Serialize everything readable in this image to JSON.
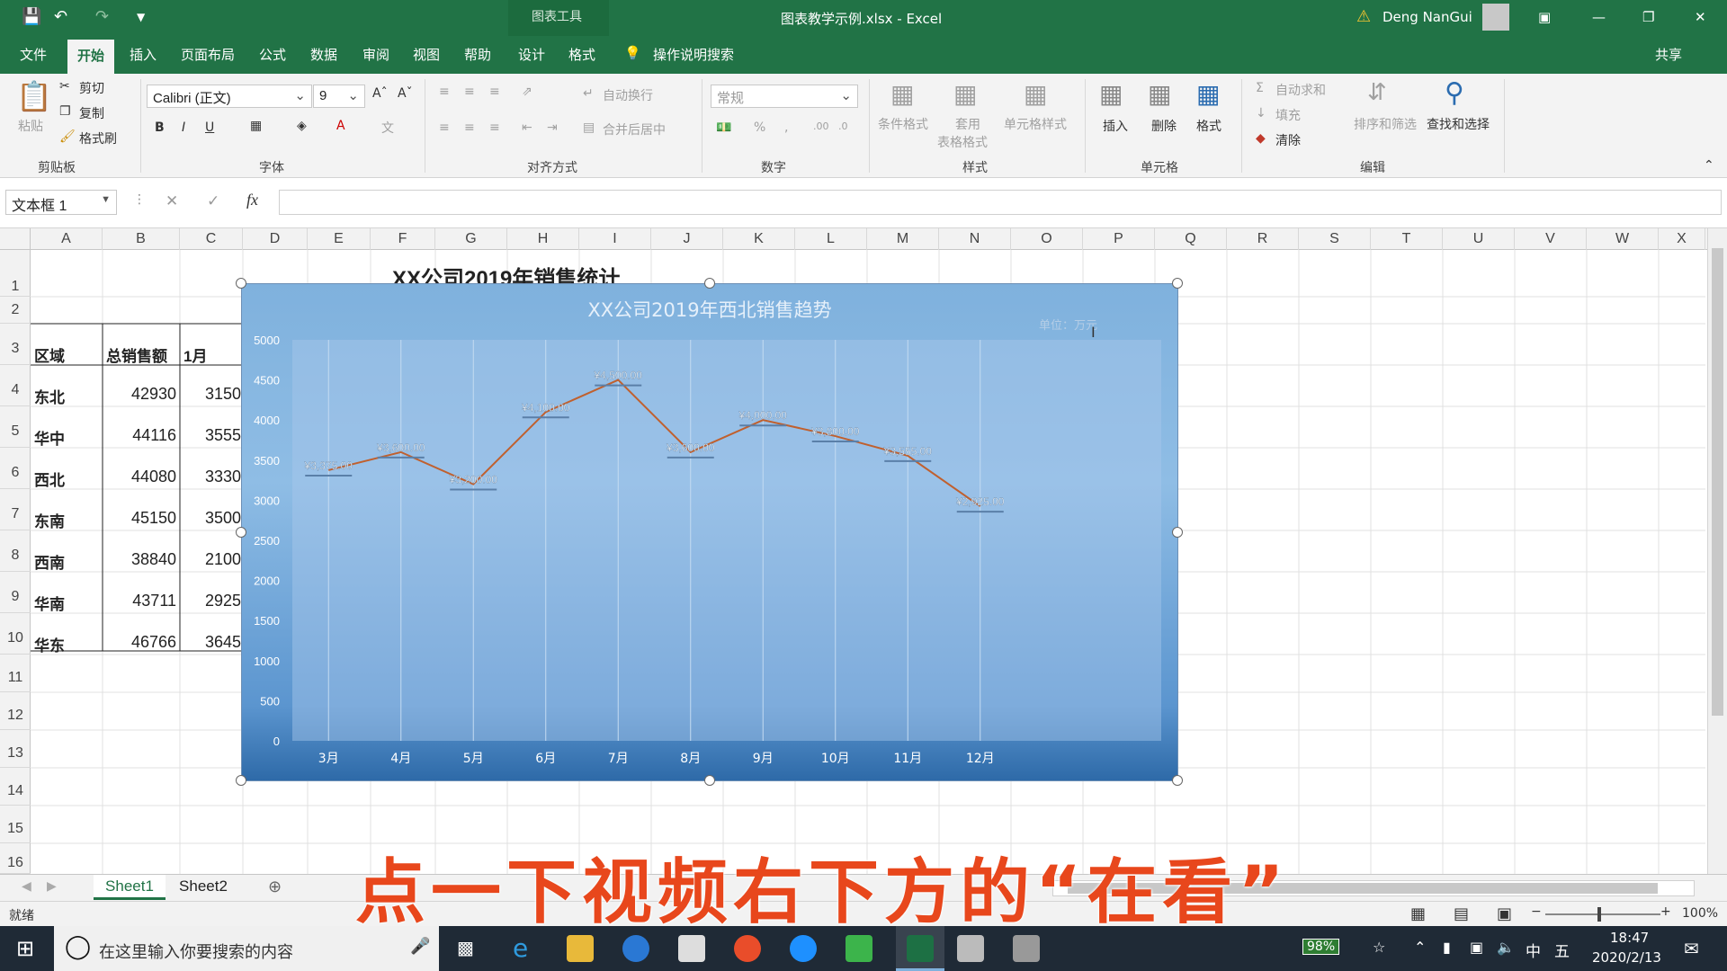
{
  "window": {
    "context_tab": "图表工具",
    "title": "图表教学示例.xlsx - Excel",
    "user": "Deng NanGui"
  },
  "tabs": [
    "文件",
    "开始",
    "插入",
    "页面布局",
    "公式",
    "数据",
    "审阅",
    "视图",
    "帮助",
    "设计",
    "格式"
  ],
  "tell_me": "操作说明搜索",
  "share": "共享",
  "ribbon": {
    "clipboard": {
      "paste": "粘贴",
      "cut": "剪切",
      "copy": "复制",
      "painter": "格式刷",
      "group": "剪贴板"
    },
    "font": {
      "name": "Calibri (正文)",
      "size": "9",
      "group": "字体"
    },
    "align": {
      "wrap": "自动换行",
      "merge": "合并后居中",
      "group": "对齐方式"
    },
    "number": {
      "format": "常规",
      "group": "数字"
    },
    "styles": {
      "cond": "条件格式",
      "table1": "套用",
      "table2": "表格格式",
      "cell": "单元格样式",
      "group": "样式"
    },
    "cells": {
      "insert": "插入",
      "delete": "删除",
      "format": "格式",
      "group": "单元格"
    },
    "editing": {
      "autosum": "自动求和",
      "fill": "填充",
      "clear": "清除",
      "sort": "排序和筛选",
      "find": "查找和选择",
      "group": "编辑"
    }
  },
  "formula_bar": {
    "name_box": "文本框 1",
    "value": ""
  },
  "columns": [
    "A",
    "B",
    "C",
    "D",
    "E",
    "F",
    "G",
    "H",
    "I",
    "J",
    "K",
    "L",
    "M",
    "N",
    "O",
    "P",
    "Q",
    "R",
    "S",
    "T",
    "U",
    "V",
    "W",
    "X"
  ],
  "rows": [
    "1",
    "2",
    "3",
    "4",
    "5",
    "6",
    "7",
    "8",
    "9",
    "10",
    "11",
    "12",
    "13",
    "14",
    "15",
    "16"
  ],
  "sheet": {
    "title": "XX公司2019年销售统计",
    "headers": [
      "区域",
      "总销售额",
      "1月"
    ],
    "data": [
      [
        "东北",
        "42930",
        "3150"
      ],
      [
        "华中",
        "44116",
        "3555"
      ],
      [
        "西北",
        "44080",
        "3330"
      ],
      [
        "东南",
        "45150",
        "3500"
      ],
      [
        "西南",
        "38840",
        "2100"
      ],
      [
        "华南",
        "43711",
        "2925"
      ],
      [
        "华东",
        "46766",
        "3645"
      ]
    ]
  },
  "chart_data": {
    "type": "line",
    "title": "XX公司2019年西北销售趋势",
    "annotation": "单位：万元",
    "categories": [
      "3月",
      "4月",
      "5月",
      "6月",
      "7月",
      "8月",
      "9月",
      "10月",
      "11月",
      "12月"
    ],
    "values": [
      3375,
      3600,
      3200,
      4100,
      4500,
      3600,
      4000,
      3800,
      3555,
      2925
    ],
    "data_labels": [
      "¥3,375.00",
      "¥3,600.00",
      "¥3,200.00",
      "¥4,100.00",
      "¥4,500.00",
      "¥3,600.00",
      "¥4,000.00",
      "¥3,800.00",
      "¥3,555.00",
      "¥2,925.00"
    ],
    "y_ticks": [
      "0",
      "500",
      "1000",
      "1500",
      "2000",
      "2500",
      "3000",
      "3500",
      "4000",
      "4500",
      "5000"
    ],
    "ylim": [
      0,
      5000
    ],
    "line_color": "#c0602e"
  },
  "sheet_tabs": [
    "Sheet1",
    "Sheet2"
  ],
  "status": {
    "ready": "就绪",
    "zoom": "100%"
  },
  "banner": "点一下视频右下方的“在看”",
  "taskbar": {
    "search": "在这里输入你要搜索的内容",
    "battery": "98%",
    "ime1": "中",
    "ime2": "五",
    "time": "18:47",
    "date": "2020/2/13"
  }
}
